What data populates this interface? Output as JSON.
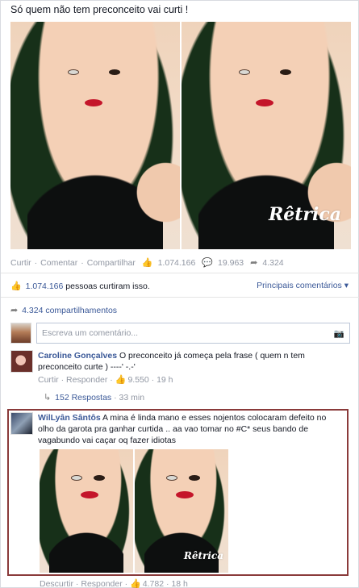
{
  "post": {
    "text": "Só quem não tem preconceito vai curti !",
    "watermark": "Rêtrica",
    "actions": {
      "like": "Curtir",
      "comment": "Comentar",
      "share": "Compartilhar",
      "like_count": "1.074.166",
      "comment_count": "19.963",
      "share_count": "4.324"
    },
    "likes_summary": {
      "count": "1.074.166",
      "text": " pessoas curtiram isso."
    },
    "top_comments_label": "Principais comentários ▾",
    "shares_summary": "4.324 compartilhamentos",
    "comment_placeholder": "Escreva um comentário..."
  },
  "comments": [
    {
      "name": "Caroline Gonçalves",
      "text": " O preconceito já começa pela frase ( quem n tem preconceito curte ) ----' -.-'",
      "like_label": "Curtir",
      "reply_label": "Responder",
      "likes": "9.550",
      "time": "19 h",
      "replies_label": "152 Respostas",
      "replies_time": "33 min"
    },
    {
      "name": "WilLyân Sântôs",
      "text": " A mina é linda mano e esses nojentos colocaram defeito no olho da garota pra ganhar curtida .. aa vao tomar no #C* seus bando de vagabundo vai caçar oq fazer idiotas",
      "watermark": "Rêtrica",
      "like_label": "Descurtir",
      "reply_label": "Responder",
      "likes": "4.782",
      "time": "18 h"
    }
  ],
  "colors": {
    "link": "#3b5998",
    "muted": "#9197a3",
    "highlight_border": "#8a3a3a"
  }
}
